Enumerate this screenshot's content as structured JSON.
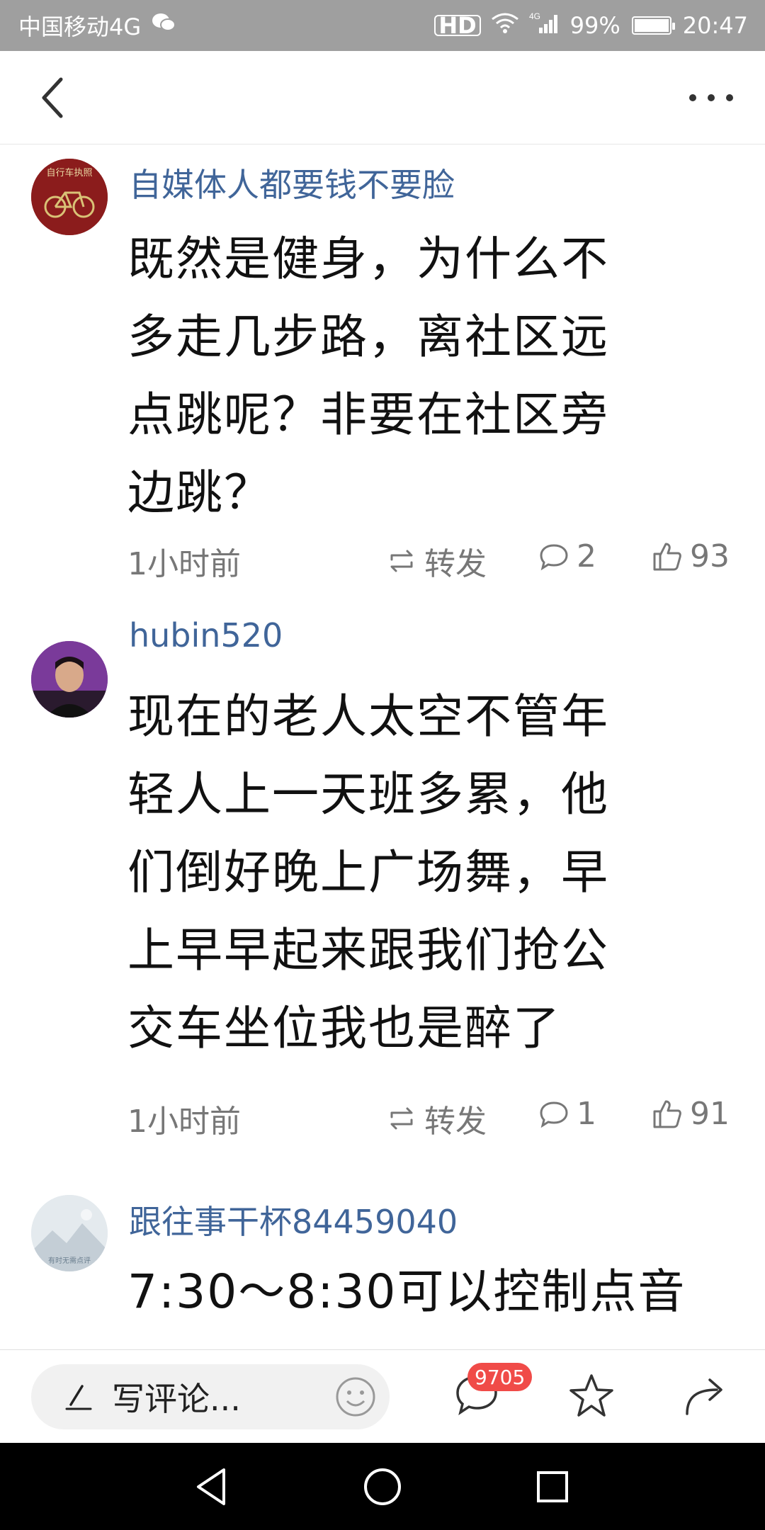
{
  "status_bar": {
    "carrier": "中国移动4G",
    "hd": "HD",
    "network": "4G",
    "battery": "99%",
    "time": "20:47"
  },
  "nav": {
    "back_icon": "chevron-left-icon",
    "more_icon": "more-dots-icon"
  },
  "comments": [
    {
      "username": "自媒体人都要钱不要脸",
      "lines": [
        "既然是健身，为什么不",
        "多走几步路，离社区远",
        "点跳呢？非要在社区旁",
        "边跳？"
      ],
      "time": "1小时前",
      "repost": "转发",
      "replies": "2",
      "likes": "93",
      "avatar_text": "自行车执照"
    },
    {
      "username": "hubin520",
      "lines": [
        "现在的老人太空不管年",
        "轻人上一天班多累，他",
        "们倒好晚上广场舞，早",
        "上早早起来跟我们抢公",
        "交车坐位我也是醉了"
      ],
      "time": "1小时前",
      "repost": "转发",
      "replies": "1",
      "likes": "91"
    },
    {
      "username": "跟往事干杯84459040",
      "lines": [
        "7:30～8:30可以控制点音"
      ],
      "avatar_text": "有时无需点评"
    }
  ],
  "action_bar": {
    "input_placeholder": "写评论...",
    "comment_count": "9705"
  },
  "colors": {
    "username": "#406599",
    "badge": "#f04b48",
    "status_bar": "#9f9f9f"
  }
}
